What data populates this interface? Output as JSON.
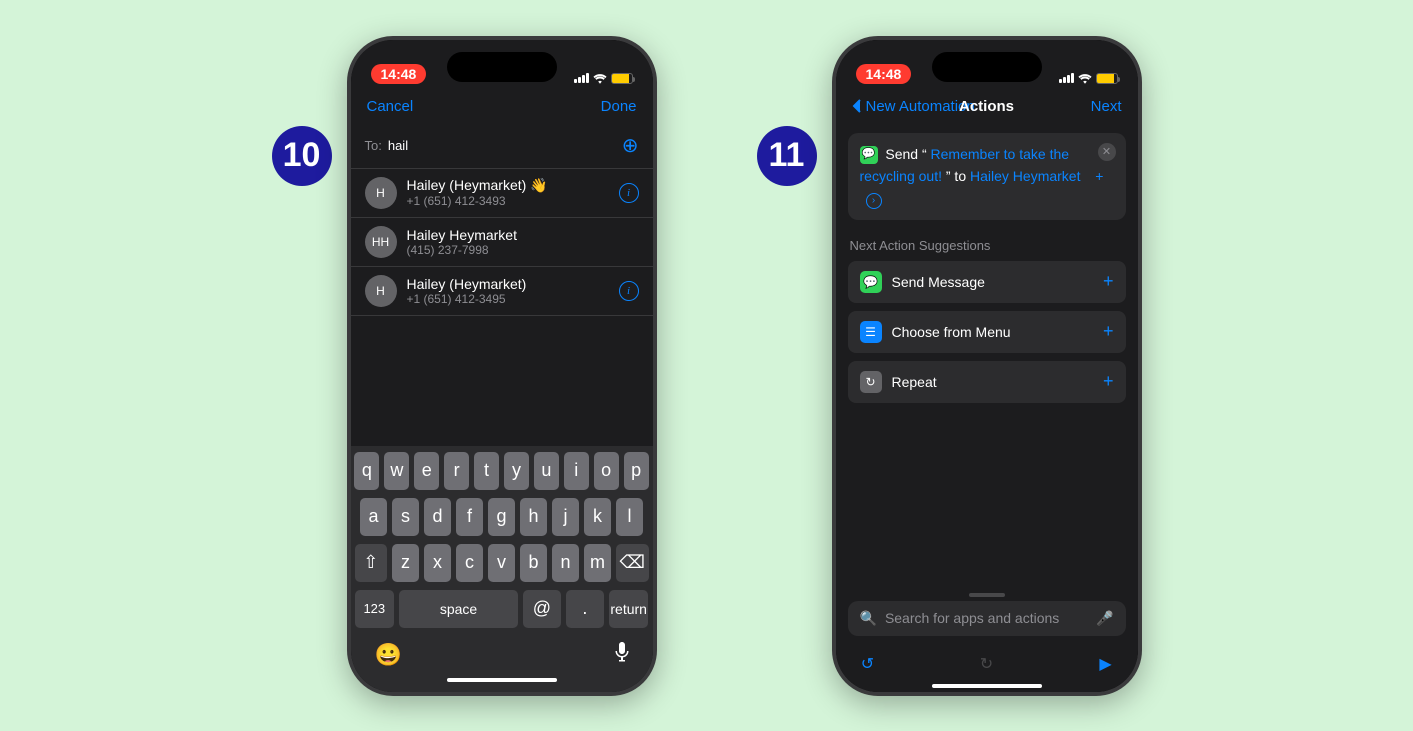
{
  "status": {
    "time": "14:48"
  },
  "step10": {
    "badge": "10",
    "nav": {
      "cancel": "Cancel",
      "done": "Done"
    },
    "to": {
      "label": "To:",
      "value": "hail"
    },
    "contacts": [
      {
        "initials": "H",
        "name": "Hailey (Heymarket) 👋",
        "sub": "+1 (651) 412-3493",
        "info": true
      },
      {
        "initials": "HH",
        "name": "Hailey Heymarket",
        "sub": "(415) 237-7998",
        "info": false
      },
      {
        "initials": "H",
        "name": "Hailey (Heymarket)",
        "sub": "+1 (651) 412-3495",
        "info": true
      }
    ],
    "keyboard": {
      "row1": [
        "q",
        "w",
        "e",
        "r",
        "t",
        "y",
        "u",
        "i",
        "o",
        "p"
      ],
      "row2": [
        "a",
        "s",
        "d",
        "f",
        "g",
        "h",
        "j",
        "k",
        "l"
      ],
      "row3": [
        "z",
        "x",
        "c",
        "v",
        "b",
        "n",
        "m"
      ],
      "num": "123",
      "space": "space",
      "at": "@",
      "dot": ".",
      "return": "return"
    }
  },
  "step11": {
    "badge": "11",
    "nav": {
      "back": "New Automation",
      "title": "Actions",
      "next": "Next"
    },
    "action": {
      "prefix": "Send “",
      "message": "Remember to take the recycling out!",
      "mid": "” to",
      "recipient": "Hailey Heymarket"
    },
    "suggestions_header": "Next Action Suggestions",
    "suggestions": [
      {
        "icon": "green",
        "glyph": "💬",
        "label": "Send Message"
      },
      {
        "icon": "blue",
        "glyph": "☰",
        "label": "Choose from Menu"
      },
      {
        "icon": "gray",
        "glyph": "↻",
        "label": "Repeat"
      }
    ],
    "search": {
      "placeholder": "Search for apps and actions"
    }
  }
}
